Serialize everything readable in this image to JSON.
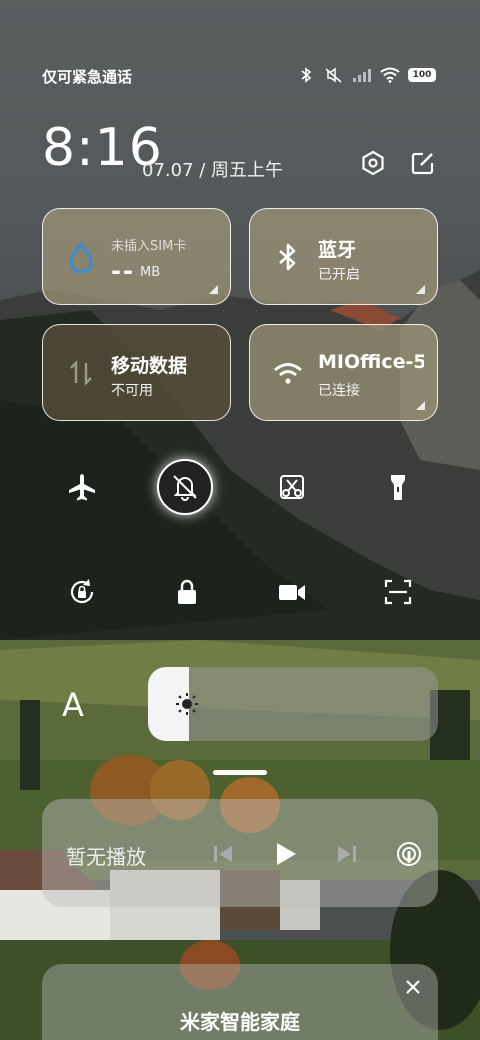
{
  "status_bar": {
    "carrier_text": "仅可紧急通话",
    "battery_level": "100",
    "icons": [
      "bluetooth-icon",
      "silent-icon",
      "signal-icon",
      "wifi-icon",
      "battery-icon"
    ]
  },
  "header": {
    "time": "8:16",
    "date": "07.07 / 周五上午",
    "actions": [
      "settings-icon",
      "edit-icon"
    ]
  },
  "tiles": {
    "data_usage": {
      "label": "未插入SIM卡",
      "value": "--",
      "unit": "MB",
      "icon": "water-drop-icon"
    },
    "bluetooth": {
      "title": "蓝牙",
      "status": "已开启",
      "icon": "bluetooth-icon"
    },
    "mobile_data": {
      "title": "移动数据",
      "status": "不可用",
      "icon": "data-arrows-icon"
    },
    "wifi": {
      "title": "MIOffice-5G",
      "status": "已连接",
      "icon": "wifi-icon"
    }
  },
  "toggles": [
    {
      "name": "airplane-mode",
      "icon": "airplane-icon",
      "active": false
    },
    {
      "name": "silent-mode",
      "icon": "bell-off-icon",
      "active": true
    },
    {
      "name": "screenshot",
      "icon": "scissors-icon",
      "active": false
    },
    {
      "name": "flashlight",
      "icon": "flashlight-icon",
      "active": false
    },
    {
      "name": "auto-rotate",
      "icon": "rotate-lock-icon",
      "active": false
    },
    {
      "name": "lock-screen",
      "icon": "lock-icon",
      "active": false
    },
    {
      "name": "screen-record",
      "icon": "video-camera-icon",
      "active": false
    },
    {
      "name": "scanner",
      "icon": "scan-icon",
      "active": false
    }
  ],
  "brightness": {
    "font_button": "A",
    "level": 0.14
  },
  "media": {
    "status_text": "暂无播放",
    "controls": [
      "previous-icon",
      "play-icon",
      "next-icon",
      "cast-icon"
    ]
  },
  "smart_home": {
    "title": "米家智能家庭"
  },
  "colors": {
    "tile_light": "#a0967a",
    "tile_dark": "#584e3a",
    "active_toggle": "#222222",
    "drop_icon": "#2f8fe0"
  }
}
